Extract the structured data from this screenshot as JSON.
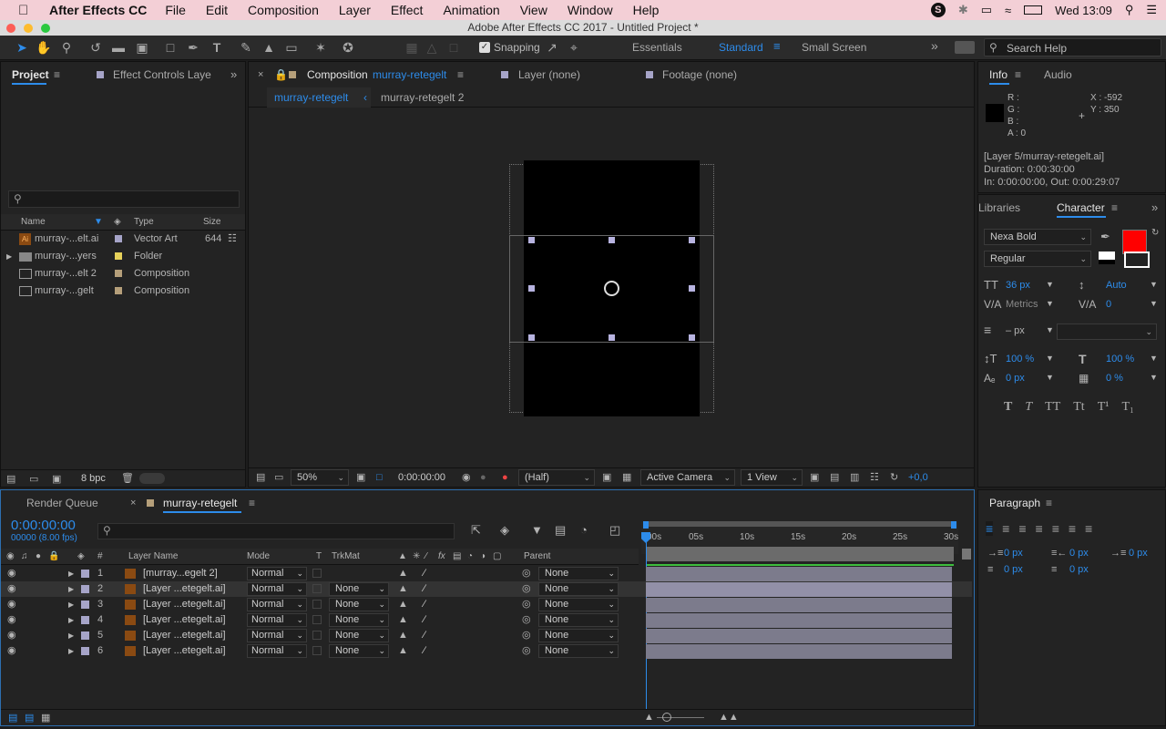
{
  "menubar": {
    "app": "After Effects CC",
    "items": [
      "File",
      "Edit",
      "Composition",
      "Layer",
      "Effect",
      "Animation",
      "View",
      "Window",
      "Help"
    ],
    "clock": "Wed 13:09"
  },
  "titlebar": {
    "title": "Adobe After Effects CC 2017 - Untitled Project *"
  },
  "toolbar": {
    "snapping": "Snapping",
    "workspaces": [
      "Essentials",
      "Standard",
      "Small Screen"
    ],
    "search_placeholder": "Search Help"
  },
  "project": {
    "tab": "Project",
    "tab2": "Effect Controls Laye",
    "columns": [
      "Name",
      "Type",
      "Size"
    ],
    "items": [
      {
        "name": "murray-...elt.ai",
        "type": "Vector Art",
        "size": "644",
        "color": "#a6a4c8"
      },
      {
        "name": "murray-...yers",
        "type": "Folder",
        "size": "",
        "color": "#e6d15a"
      },
      {
        "name": "murray-...elt 2",
        "type": "Composition",
        "size": "",
        "color": "#b59f7a"
      },
      {
        "name": "murray-...gelt",
        "type": "Composition",
        "size": "",
        "color": "#b59f7a"
      }
    ],
    "bpc": "8 bpc"
  },
  "composition": {
    "label": "Composition",
    "name": "murray-retegelt",
    "tab_layer": "Layer (none)",
    "tab_footage": "Footage (none)",
    "breadcrumb": [
      "murray-retegelt",
      "murray-retegelt 2"
    ],
    "zoom": "50%",
    "time": "0:00:00:00",
    "resolution": "(Half)",
    "camera": "Active Camera",
    "views": "1 View",
    "exposure": "+0,0"
  },
  "info": {
    "tab": "Info",
    "tab2": "Audio",
    "r": "R :",
    "g": "G :",
    "b": "B :",
    "a": "A :  0",
    "x": "X : -592",
    "y": "Y : 350",
    "layer": "[Layer 5/murray-retegelt.ai]",
    "duration": "Duration: 0:00:30:00",
    "inout": "In: 0:00:00:00, Out: 0:00:29:07"
  },
  "character": {
    "tab_lib": "Libraries",
    "tab": "Character",
    "font": "Nexa Bold",
    "style": "Regular",
    "size": "36 px",
    "leading": "Auto",
    "kerning": "Metrics",
    "tracking": "0",
    "stroke": "– px",
    "vscale": "100 %",
    "hscale": "100 %",
    "baseline": "0 px",
    "tsume": "0 %",
    "fill_color": "#ff0000",
    "styles": [
      "T",
      "T",
      "TT",
      "Tt",
      "T¹",
      "T₁"
    ]
  },
  "paragraph": {
    "tab": "Paragraph",
    "indent_left": "0 px",
    "indent_right": "0 px",
    "indent_first": "0 px",
    "space_before": "0 px",
    "space_after": "0 px"
  },
  "timeline": {
    "tab_render": "Render Queue",
    "tab_comp": "murray-retegelt",
    "time": "0:00:00:00",
    "frames": "00000 (8.00 fps)",
    "columns": {
      "num": "#",
      "name": "Layer Name",
      "mode": "Mode",
      "t": "T",
      "trkmat": "TrkMat",
      "parent": "Parent"
    },
    "ruler": [
      "00s",
      "05s",
      "10s",
      "15s",
      "20s",
      "25s",
      "30s"
    ],
    "layers": [
      {
        "num": "1",
        "name": "[murray...egelt 2]",
        "mode": "Normal",
        "trkmat": "",
        "parent": "None"
      },
      {
        "num": "2",
        "name": "[Layer ...etegelt.ai]",
        "mode": "Normal",
        "trkmat": "None",
        "parent": "None"
      },
      {
        "num": "3",
        "name": "[Layer ...etegelt.ai]",
        "mode": "Normal",
        "trkmat": "None",
        "parent": "None"
      },
      {
        "num": "4",
        "name": "[Layer ...etegelt.ai]",
        "mode": "Normal",
        "trkmat": "None",
        "parent": "None"
      },
      {
        "num": "5",
        "name": "[Layer ...etegelt.ai]",
        "mode": "Normal",
        "trkmat": "None",
        "parent": "None"
      },
      {
        "num": "6",
        "name": "[Layer ...etegelt.ai]",
        "mode": "Normal",
        "trkmat": "None",
        "parent": "None"
      }
    ]
  }
}
